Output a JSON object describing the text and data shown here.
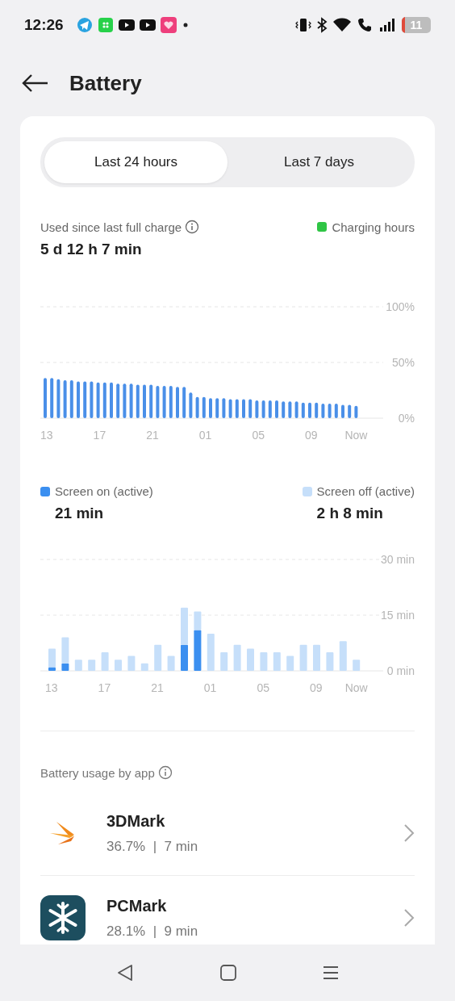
{
  "status_bar": {
    "time": "12:26",
    "battery": "11"
  },
  "header": {
    "title": "Battery"
  },
  "tabs": [
    {
      "label": "Last 24 hours",
      "selected": true
    },
    {
      "label": "Last 7 days",
      "selected": false
    }
  ],
  "usage": {
    "label": "Used since last full charge",
    "value": "5 d 12 h 7 min",
    "legend": {
      "label": "Charging hours",
      "color": "#2fc545"
    }
  },
  "level_chart": {
    "chart_data": {
      "type": "bar",
      "ylim": [
        0,
        100
      ],
      "yticks": [
        {
          "value": 0,
          "label": "0%"
        },
        {
          "value": 50,
          "label": "50%"
        },
        {
          "value": 100,
          "label": "100%"
        }
      ],
      "categories": [
        "13",
        null,
        null,
        null,
        null,
        null,
        null,
        null,
        "17",
        null,
        null,
        null,
        null,
        null,
        null,
        null,
        "21",
        null,
        null,
        null,
        null,
        null,
        null,
        null,
        "01",
        null,
        null,
        null,
        null,
        null,
        null,
        null,
        "05",
        null,
        null,
        null,
        null,
        null,
        null,
        null,
        "09",
        null,
        null,
        null,
        null,
        null,
        null,
        "Now"
      ],
      "series": [
        {
          "color": "#4a8fe8",
          "values": [
            36,
            36,
            35,
            34,
            34,
            33,
            33,
            33,
            32,
            32,
            32,
            31,
            31,
            31,
            30,
            30,
            30,
            29,
            29,
            29,
            28,
            28,
            23,
            19,
            19,
            18,
            18,
            18,
            17,
            17,
            17,
            17,
            16,
            16,
            16,
            16,
            15,
            15,
            15,
            14,
            14,
            14,
            13,
            13,
            13,
            12,
            12,
            11
          ]
        }
      ]
    }
  },
  "screen_time": [
    {
      "value": "21 min"
    },
    {
      "value": "2 h 8 min"
    }
  ],
  "screen_chart": {
    "chart_data": {
      "type": "bar",
      "stacked": true,
      "ylim": [
        0,
        30
      ],
      "yticks": [
        {
          "value": 0,
          "label": "0 min"
        },
        {
          "value": 15,
          "label": "15 min"
        },
        {
          "value": 30,
          "label": "30 min"
        }
      ],
      "categories": [
        "13",
        null,
        null,
        null,
        "17",
        null,
        null,
        null,
        "21",
        null,
        null,
        null,
        "01",
        null,
        null,
        null,
        "05",
        null,
        null,
        null,
        "09",
        null,
        null,
        "Now"
      ],
      "series": [
        {
          "name": "Screen on (active)",
          "color": "#3b8ff0",
          "values": [
            1,
            2,
            0,
            0,
            0,
            0,
            0,
            0,
            0,
            0,
            7,
            11,
            0,
            0,
            0,
            0,
            0,
            0,
            0,
            0,
            0,
            0,
            0,
            0
          ]
        },
        {
          "name": "Screen off (active)",
          "color": "#c6dffa",
          "values": [
            5,
            7,
            3,
            3,
            5,
            3,
            4,
            2,
            7,
            4,
            10,
            5,
            10,
            5,
            7,
            6,
            5,
            5,
            4,
            7,
            7,
            5,
            8,
            3
          ]
        }
      ]
    }
  },
  "apps": {
    "title": "Battery usage by app",
    "items": [
      {
        "name": "3DMark",
        "detail": "36.7%  |  7 min",
        "kind": "wings"
      },
      {
        "name": "PCMark",
        "detail": "28.1%  |  9 min",
        "kind": "snowflake"
      }
    ]
  }
}
